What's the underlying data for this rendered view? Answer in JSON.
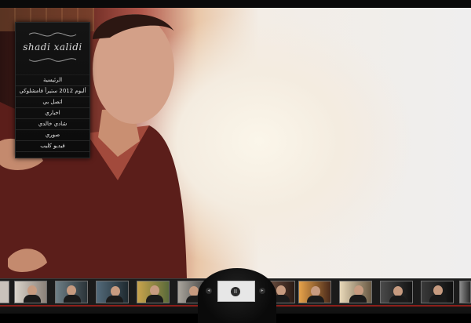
{
  "site": {
    "brand": "shadi xalidi"
  },
  "menu": {
    "items": [
      {
        "label": "الرئيسية"
      },
      {
        "label": "ألبوم 2012  ستيرأ فامشلوكي"
      },
      {
        "label": "اتصل بي"
      },
      {
        "label": "اخباري"
      },
      {
        "label": "شادي خالدي"
      },
      {
        "label": "صوري"
      },
      {
        "label": "فيديو كليب"
      }
    ]
  },
  "player": {
    "pause_icon": "pause-icon",
    "prev_icon": "chevron-left-icon",
    "next_icon": "chevron-right-icon",
    "pause_glyph": "II"
  },
  "colors": {
    "accent_red": "#8c1f1a",
    "menu_bg": "#111111"
  }
}
